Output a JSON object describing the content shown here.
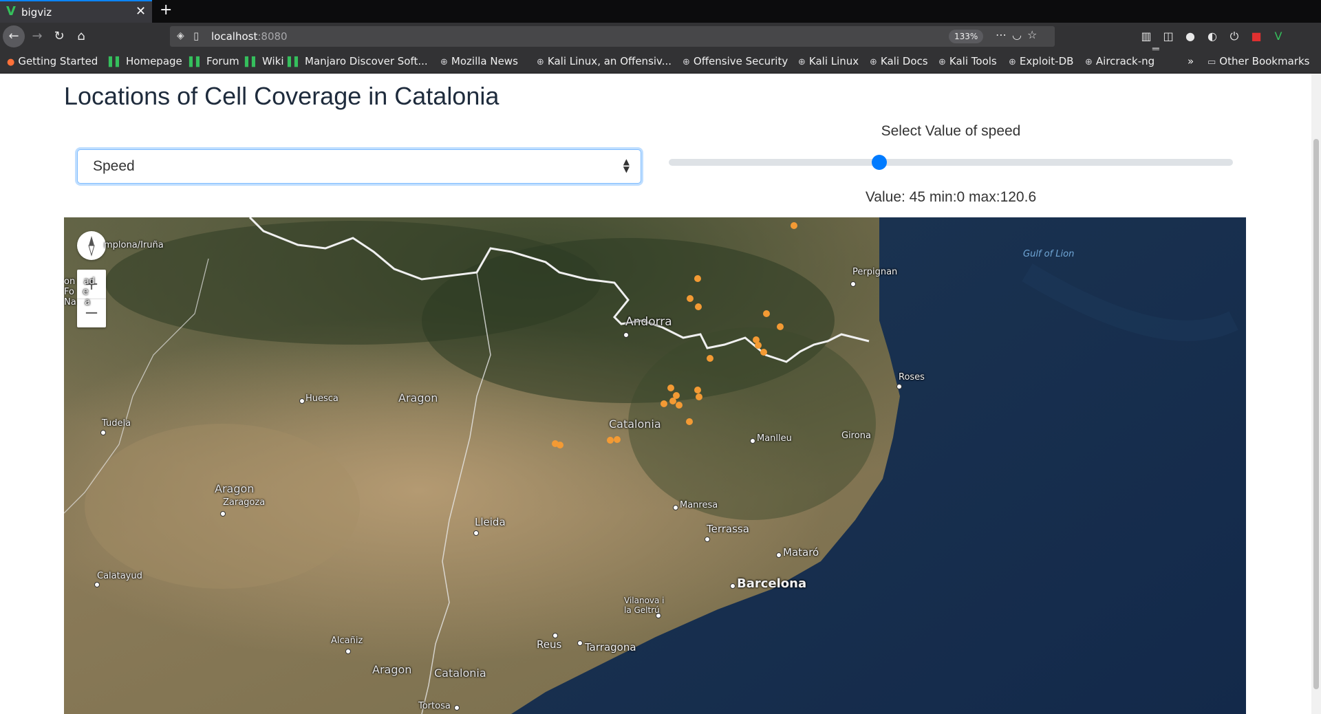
{
  "browser": {
    "tab_title": "bigviz",
    "url_host": "localhost",
    "url_port": ":8080",
    "zoom_level": "133%",
    "bookmarks": [
      "Getting Started",
      "Homepage",
      "Forum",
      "Wiki",
      "Manjaro Discover Soft...",
      "Mozilla News",
      "Kali Linux, an Offensiv...",
      "Offensive Security",
      "Kali Linux",
      "Kali Docs",
      "Kali Tools",
      "Exploit-DB",
      "Aircrack-ng"
    ],
    "other_bookmarks": "Other Bookmarks"
  },
  "page": {
    "title": "Locations of Cell Coverage in Catalonia",
    "select_value": "Speed",
    "slider_label": "Select Value of speed",
    "slider_value_text": "Value: 45 min:0 max:120.6",
    "slider": {
      "value": 45,
      "min": 0,
      "max": 120.6
    }
  },
  "map": {
    "region_labels": [
      "Aragon",
      "Aragon",
      "Aragon",
      "Catalonia",
      "Catalonia",
      "Andorra"
    ],
    "city_labels": [
      "mplona/Iruña",
      "Huesca",
      "Tudela",
      "Zaragoza",
      "Calatayud",
      "Lleida",
      "Alcañiz",
      "Tortosa",
      "Perpignan",
      "Roses",
      "Manlleu",
      "Girona",
      "Manresa",
      "Terrassa",
      "Mataró",
      "Barcelona",
      "Vilanova i la Geltrú",
      "Reus",
      "Tarragona"
    ],
    "sea_label": "Gulf of Lion",
    "partial_label": "on   ad\nFo   e\nNa   a",
    "coverage_point_color": "#f39a34",
    "coverage_point_count": 22
  }
}
